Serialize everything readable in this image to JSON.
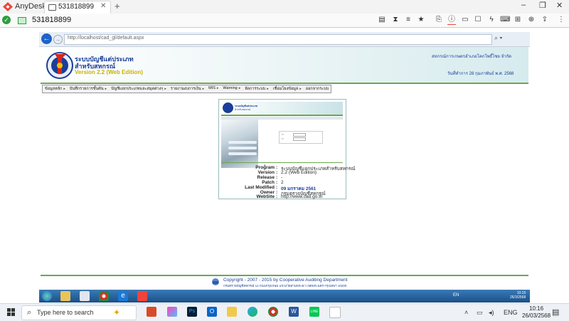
{
  "anydesk": {
    "app_name": "AnyDesk",
    "tab_label": "531818899",
    "address": "531818899"
  },
  "browser": {
    "url": "http://localhost/cad_gl/default.aspx"
  },
  "app": {
    "title_line1": "ระบบบัญชีแต่ประเภท",
    "title_line2": "สำหรับสหกรณ์",
    "version": "Version 2.2 (Web Edition)",
    "org_name": "สหกรณ์การเกษตรอำเภอโคกโพธิ์ไชย จำกัด",
    "date_line": "วันที่ทำการ 28 กุมภาพันธ์ พ.ศ. 2568",
    "menu": [
      "ข้อมูลหลัก",
      "บันทึกรายการขั้นต้น",
      "บัญชีแยกประเภทและสมุดต่างๆ",
      "รายงานงบการเงิน",
      "MIS",
      "Warning",
      "จัดการระบบ",
      "เชื่อมโยงข้อมูล",
      "ออกจากระบบ"
    ]
  },
  "login_panel": {
    "mini_title1": "ระบบบัญชีแต่ประเภท",
    "mini_title2": "สำหรับสหกรณ์",
    "info": [
      {
        "key": "Program",
        "value": "ระบบบัญชีแยกประเภทสำหรับสหกรณ์"
      },
      {
        "key": "Version",
        "value": "2.2 (Web Edition)"
      },
      {
        "key": "Release",
        "value": "-"
      },
      {
        "key": "Patch",
        "value": "2"
      },
      {
        "key": "Last Modified",
        "value": "09 มกราคม 2561"
      },
      {
        "key": "Owner",
        "value": "กรมตรวจบัญชีสหกรณ์"
      },
      {
        "key": "WebSite",
        "value": "http://www.cad.go.th"
      }
    ]
  },
  "footer": {
    "copyright": "Copyright - 2007 - 2015 by Cooperative Auditing Department",
    "address": "กรมตรวจบัญชีสหกรณ์ 12 ถนนกรุงเกษม แขวงวัดสามพระยา เขตพระนคร กรุงเทพฯ 10200"
  },
  "remote_taskbar": {
    "lang": "EN",
    "time": "10:15",
    "date": "26/3/2568"
  },
  "windows_taskbar": {
    "search_placeholder": "Type here to search",
    "lang": "ENG",
    "time": "10:16",
    "date": "26/03/2568"
  },
  "colors": {
    "brand_blue": "#1a3f9a",
    "green_accent": "#6aa84f",
    "anydesk_red": "#ef443b"
  }
}
